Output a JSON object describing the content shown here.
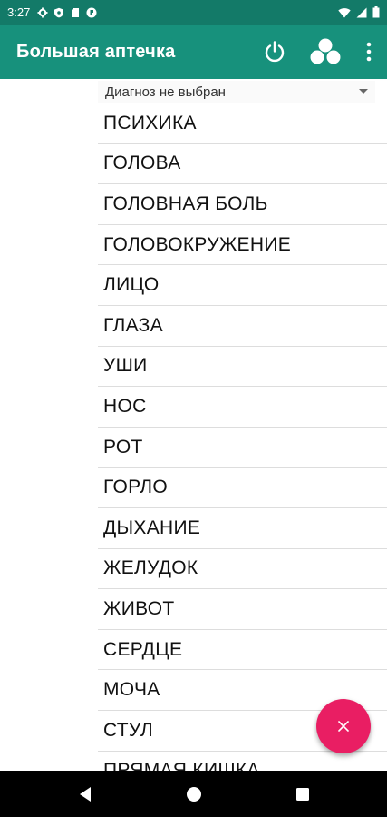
{
  "status_bar": {
    "time": "3:27",
    "icons": [
      "gear-icon",
      "shield-icon",
      "sd-card-icon",
      "vpn-icon"
    ],
    "right_icons": [
      "wifi-icon",
      "cell-signal-icon",
      "battery-icon"
    ]
  },
  "app_bar": {
    "title": "Большая аптечка",
    "actions": [
      "power-icon",
      "three-circles-icon",
      "more-vert-icon"
    ],
    "color": "#17917c"
  },
  "spinner": {
    "selected": "Диагноз не выбран"
  },
  "list": {
    "items": [
      "ПСИХИКА",
      "ГОЛОВА",
      "ГОЛОВНАЯ БОЛЬ",
      "ГОЛОВОКРУЖЕНИЕ",
      "ЛИЦО",
      "ГЛАЗА",
      "УШИ",
      "НОС",
      "РОТ",
      "ГОРЛО",
      "ДЫХАНИЕ",
      "ЖЕЛУДОК",
      "ЖИВОТ",
      "СЕРДЦЕ",
      "МОЧА",
      "СТУЛ",
      "ПРЯМАЯ КИШКА"
    ]
  },
  "fab": {
    "icon": "close-icon",
    "color": "#e91e63"
  },
  "nav_bar": {
    "buttons": [
      "back-icon",
      "home-icon",
      "recents-icon"
    ]
  }
}
